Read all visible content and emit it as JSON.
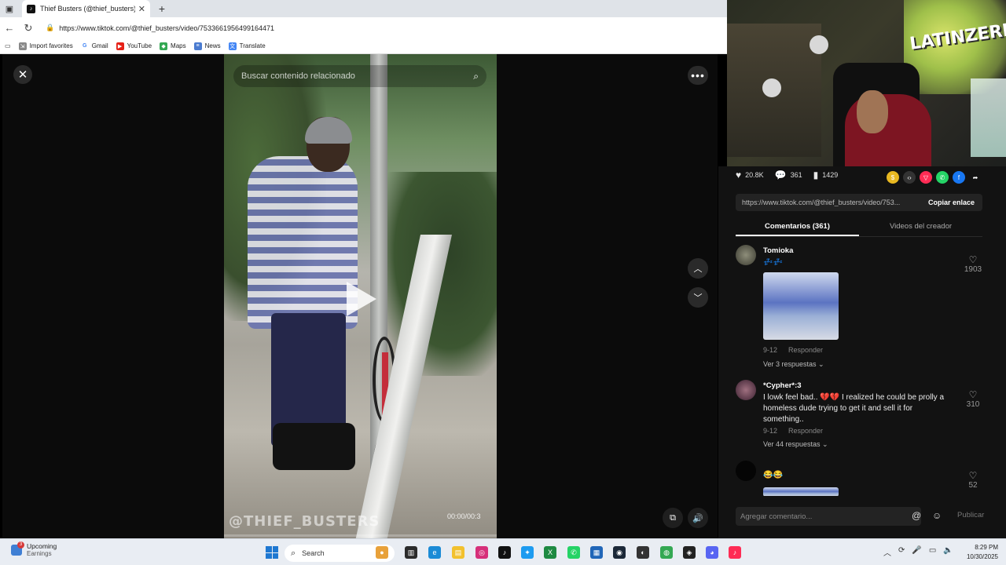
{
  "browser": {
    "tab_title": "Thief Busters (@thief_busters) | Ti",
    "tab_favicon": "tiktok-icon",
    "url": "https://www.tiktok.com/@thief_busters/video/7533661956499164471",
    "bookmarks": [
      {
        "label": "Import favorites",
        "icon": "import-icon"
      },
      {
        "label": "Gmail",
        "icon": "google-icon"
      },
      {
        "label": "YouTube",
        "icon": "youtube-icon"
      },
      {
        "label": "Maps",
        "icon": "maps-icon"
      },
      {
        "label": "News",
        "icon": "news-icon"
      },
      {
        "label": "Translate",
        "icon": "translate-icon"
      }
    ]
  },
  "video": {
    "search_placeholder": "Buscar contenido relacionado",
    "watermark": "@THIEF_BUSTERS",
    "time": "00:00/00:3",
    "progress": 0
  },
  "webcam": {
    "graffiti_text": "LATINZERIA"
  },
  "actions": {
    "likes": "20.8K",
    "comments": "361",
    "saves": "1429"
  },
  "link": {
    "url": "https://www.tiktok.com/@thief_busters/video/753...",
    "copy_label": "Copiar enlace"
  },
  "tabs": {
    "comments": "Comentarios (361)",
    "creator_videos": "Videos del creador"
  },
  "comments": [
    {
      "user": "Tomioka",
      "text": "💤💤",
      "date": "9-12",
      "reply": "Responder",
      "replies": "Ver 3 respuestas",
      "likes": "1903"
    },
    {
      "user": "*Cypher*:3",
      "text": "I lowk feel bad.. 💔💔 I realized he could be prolly a homeless dude trying to get it and sell it for something..",
      "date": "9-12",
      "reply": "Responder",
      "replies": "Ver 44 respuestas",
      "likes": "310"
    },
    {
      "user": "",
      "text": "😂😂",
      "likes": "52"
    }
  ],
  "composer": {
    "placeholder": "Agregar comentario...",
    "publish": "Publicar"
  },
  "taskbar": {
    "widget_title": "Upcoming",
    "widget_sub": "Earnings",
    "widget_badge": "3",
    "search": "Search",
    "time": "8:29 PM",
    "date": "10/30/2025"
  },
  "colors": {
    "accent_tiktok": "#fe2c55",
    "panel_bg": "#121212",
    "viewer_bg": "#0b0b0b"
  }
}
